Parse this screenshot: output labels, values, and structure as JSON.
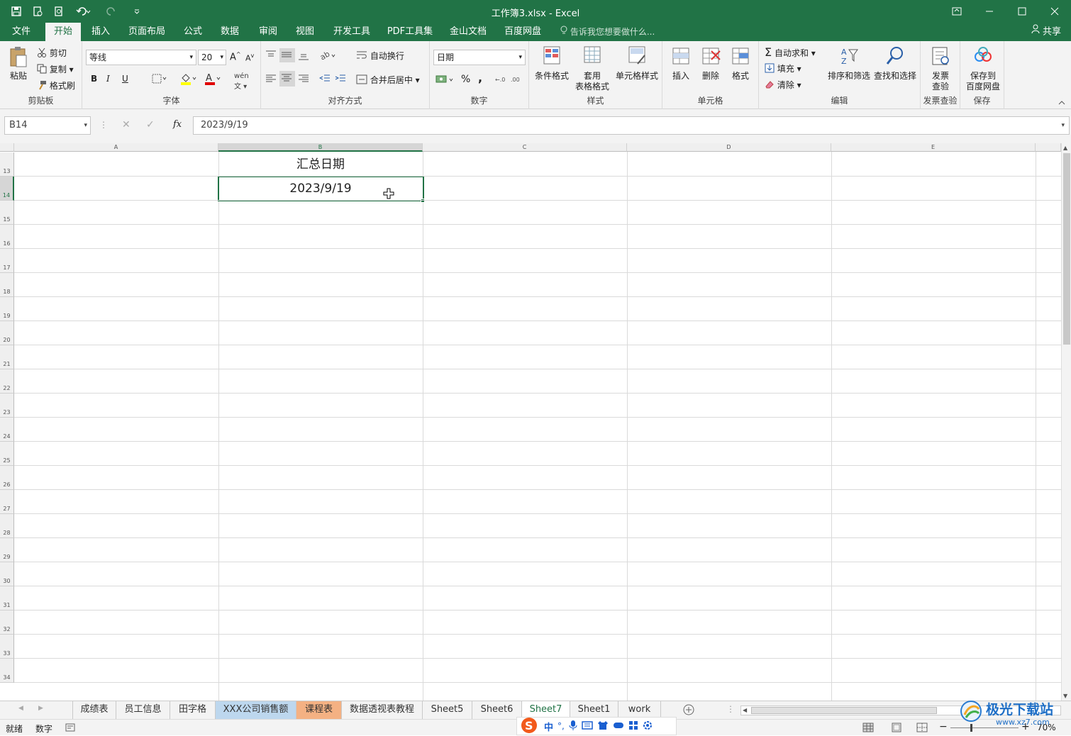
{
  "window": {
    "title": "工作簿3.xlsx - Excel"
  },
  "ribbon_tabs": [
    "文件",
    "开始",
    "插入",
    "页面布局",
    "公式",
    "数据",
    "审阅",
    "视图",
    "开发工具",
    "PDF工具集",
    "金山文档",
    "百度网盘"
  ],
  "tell_me": "告诉我您想要做什么...",
  "share": "共享",
  "clipboard": {
    "paste": "粘贴",
    "cut": "剪切",
    "copy": "复制",
    "painter": "格式刷",
    "label": "剪贴板"
  },
  "font": {
    "name": "等线",
    "size": "20",
    "label": "字体",
    "bold": "B",
    "italic": "I",
    "underline": "U"
  },
  "alignment": {
    "wrap": "自动换行",
    "merge": "合并后居中",
    "label": "对齐方式"
  },
  "number": {
    "format": "日期",
    "percent": "%",
    "comma": ",",
    "label": "数字"
  },
  "styles": {
    "conditional": "条件格式",
    "table1": "套用",
    "table2": "表格格式",
    "cellstyle": "单元格样式",
    "label": "样式"
  },
  "cells": {
    "insert": "插入",
    "delete": "删除",
    "format": "格式",
    "label": "单元格"
  },
  "editing": {
    "autosum": "自动求和",
    "fill": "填充",
    "clear": "清除",
    "sort": "排序和筛选",
    "find": "查找和选择",
    "label": "编辑"
  },
  "invoice": {
    "btn1": "发票",
    "btn2": "查验",
    "label": "发票查验"
  },
  "save": {
    "btn1": "保存到",
    "btn2": "百度网盘",
    "label": "保存"
  },
  "formula_bar": {
    "name_box": "B14",
    "value": "2023/9/19"
  },
  "columns": [
    "A",
    "B",
    "C",
    "D",
    "E"
  ],
  "rows": [
    "13",
    "14",
    "15",
    "16",
    "17",
    "18",
    "19",
    "20",
    "21",
    "22",
    "23",
    "24",
    "25",
    "26",
    "27",
    "28",
    "29",
    "30",
    "31",
    "32",
    "33",
    "34"
  ],
  "cells_data": {
    "B13": "汇总日期",
    "B14": "2023/9/19"
  },
  "sheet_tabs": [
    "成绩表",
    "员工信息",
    "田字格",
    "XXX公司销售额",
    "课程表",
    "数据透视表教程",
    "Sheet5",
    "Sheet6",
    "Sheet7",
    "Sheet1",
    "work"
  ],
  "active_sheet": "Sheet7",
  "status": {
    "ready": "就绪",
    "mode": "数字",
    "zoom": "70%"
  },
  "ime": {
    "lang": "中"
  },
  "watermark": {
    "brand": "极光下载站",
    "url": "www.xz7.com"
  },
  "colors": {
    "accent": "#217346",
    "tab_blue": "#bdd7ee",
    "tab_orange": "#f4b183"
  }
}
